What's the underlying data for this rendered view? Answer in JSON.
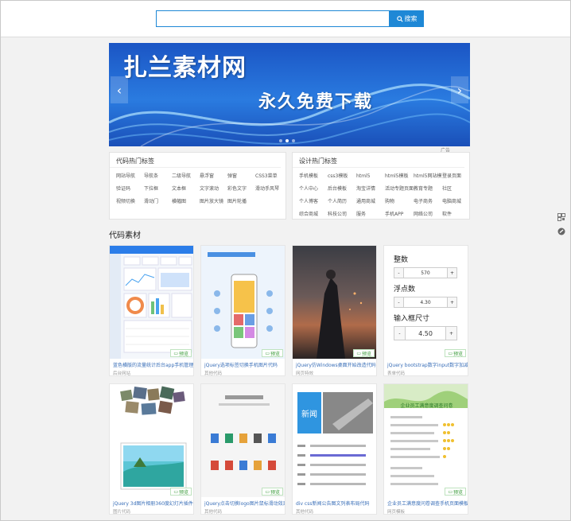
{
  "search": {
    "placeholder": "",
    "value": "",
    "button_label": "搜索"
  },
  "banner": {
    "title": "扎兰素材网",
    "subtitle": "永久免费下载",
    "ad_tag": "广告"
  },
  "code_tags": {
    "heading": "代码热门标签",
    "items": [
      "网站导航",
      "导航条",
      "二级导航",
      "悬浮窗",
      "弹窗",
      "CSS3菜单",
      "验证码",
      "下拉框",
      "文本框",
      "文字滚动",
      "彩色文字",
      "滑动手风琴",
      "视频切换",
      "滑动门",
      "横幅图",
      "图片放大镜",
      "图片轮播"
    ]
  },
  "design_tags": {
    "heading": "设计热门标签",
    "items": [
      "手机模板",
      "css3模板",
      "html5",
      "html5模板",
      "html5网站模",
      "登录页面",
      "个人中心",
      "后台模板",
      "淘宝详情",
      "活动专题页面",
      "教育专题",
      "社区",
      "个人博客",
      "个人简历",
      "通用商城",
      "购物",
      "电子商务",
      "电脑商城",
      "综合商城",
      "科技公司",
      "服务",
      "手机APP",
      "网络公司",
      "软件"
    ]
  },
  "section_title": "代码素材",
  "cards": [
    {
      "title": "蓝色横版的流量统计后台app手机管理模板",
      "category": "后台网站",
      "preview": "预览"
    },
    {
      "title": "jQuery选项标签切换手机图片代码",
      "category": "其他代码",
      "preview": "预览"
    },
    {
      "title": "jQuery仿Windows桌面开始改造代码",
      "category": "网页特效",
      "preview": "预览"
    },
    {
      "title": "jQuery bootstrap数字input数字加减插件",
      "category": "表单代码",
      "preview": "预览"
    },
    {
      "title": "jQuery 3d图片相册360度幻灯片插件",
      "category": "图片代码",
      "preview": "预览"
    },
    {
      "title": "jQuery点击切换logo图片鼠标滑动效果代码",
      "category": "其他代码",
      "preview": "预览"
    },
    {
      "title": "div css新闻公告图文列表布局代码",
      "category": "其他代码",
      "preview": "预览"
    },
    {
      "title": "企业员工满意度问卷调查手机页面模板",
      "category": "网页模板",
      "preview": "预览"
    }
  ],
  "stepper_card": {
    "groups": [
      {
        "label": "整数",
        "value": "570"
      },
      {
        "label": "浮点数",
        "value": "4.30"
      },
      {
        "label": "输入框尺寸",
        "value": "4.50"
      }
    ],
    "minus": "-",
    "plus": "+"
  },
  "news_card": {
    "badge": "新闻",
    "row_tag": "[新闻]"
  },
  "survey_card": {
    "title": "企业员工满意度调查问卷",
    "section": "一、员工满意度"
  },
  "colors": {
    "accent": "#1e88d6",
    "link": "#3a6fb8",
    "preview_green": "#3a9b3a"
  }
}
